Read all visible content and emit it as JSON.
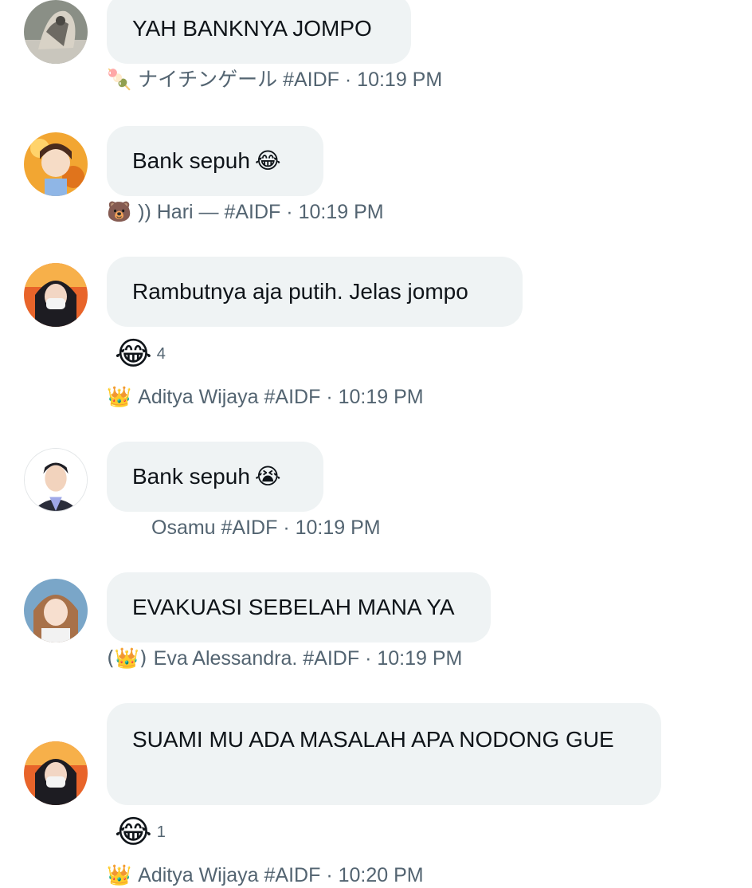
{
  "messages": [
    {
      "text": "YAH BANKNYA JOMPO",
      "text_emoji": "",
      "badge": "🍡",
      "author": "ナイチンゲール #AIDF",
      "separator": "·",
      "time": "10:19 PM"
    },
    {
      "text": "Bank sepuh",
      "text_emoji": "😂",
      "badge": "🐻",
      "author": ")) Hari — #AIDF",
      "separator": "·",
      "time": "10:19 PM"
    },
    {
      "text": "Rambutnya aja putih. Jelas jompo",
      "text_emoji": "",
      "reaction": {
        "emoji": "😂",
        "count": "4"
      },
      "badge": "👑",
      "author": "Aditya Wijaya #AIDF",
      "separator": "·",
      "time": "10:19 PM"
    },
    {
      "text": "Bank sepuh",
      "text_emoji": "😭",
      "badge": "",
      "author": "Osamu #AIDF",
      "separator": "·",
      "time": "10:19 PM"
    },
    {
      "text": "EVAKUASI SEBELAH MANA YA",
      "text_emoji": "",
      "badge": "(👑)",
      "author": "Eva Alessandra. #AIDF",
      "separator": "·",
      "time": "10:19 PM"
    },
    {
      "text": "SUAMI MU ADA MASALAH APA NODONG GUE",
      "text_emoji": "",
      "reaction": {
        "emoji": "😂",
        "count": "1"
      },
      "badge": "👑",
      "author": "Aditya Wijaya #AIDF",
      "separator": "·",
      "time": "10:20 PM"
    }
  ]
}
